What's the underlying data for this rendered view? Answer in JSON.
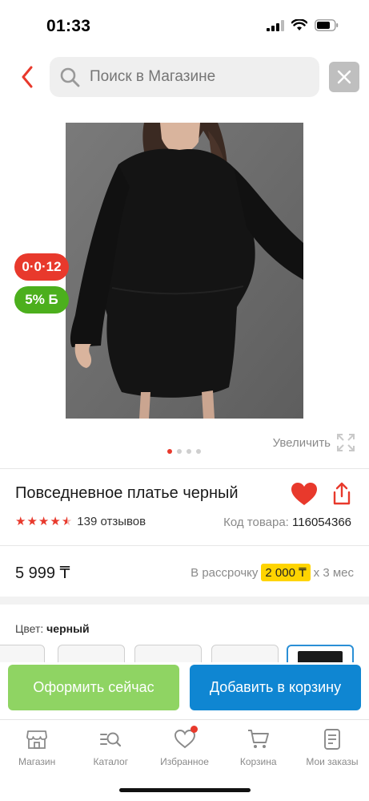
{
  "status": {
    "time": "01:33",
    "icons": [
      "signal-icon",
      "wifi-icon",
      "battery-icon"
    ]
  },
  "search": {
    "placeholder": "Поиск в Магазине",
    "back_icon": "chevron-left-icon",
    "clear_icon": "close-icon"
  },
  "product": {
    "image_alt": "black-dress-photo",
    "promo_badge": "0·0·12",
    "bonus_badge": "5% Б",
    "gallery": {
      "count": 4,
      "active": 0
    },
    "zoom_label": "Увеличить",
    "title": "Повседневное платье черный",
    "rating": 4.5,
    "reviews": "139 отзывов",
    "sku_label": "Код товара:",
    "sku_value": "116054366",
    "price": "5 999 ₸",
    "installment_prefix": "В рассрочку",
    "installment_amount": "2 000 ₸",
    "installment_suffix": "х 3 мес",
    "color_label": "Цвет:",
    "color_value": "черный"
  },
  "actions": {
    "checkout": "Оформить сейчас",
    "add_to_cart": "Добавить в корзину"
  },
  "tabs": [
    {
      "label": "Магазин",
      "icon": "shop-icon"
    },
    {
      "label": "Каталог",
      "icon": "catalog-icon"
    },
    {
      "label": "Избранное",
      "icon": "heart-icon",
      "badge": true
    },
    {
      "label": "Корзина",
      "icon": "cart-icon"
    },
    {
      "label": "Мои заказы",
      "icon": "orders-icon"
    }
  ],
  "colors": {
    "accent": "#e8392c",
    "green": "#8fd463",
    "blue": "#0f86d2",
    "bonus": "#4caf1d",
    "installment_highlight": "#ffd400"
  }
}
